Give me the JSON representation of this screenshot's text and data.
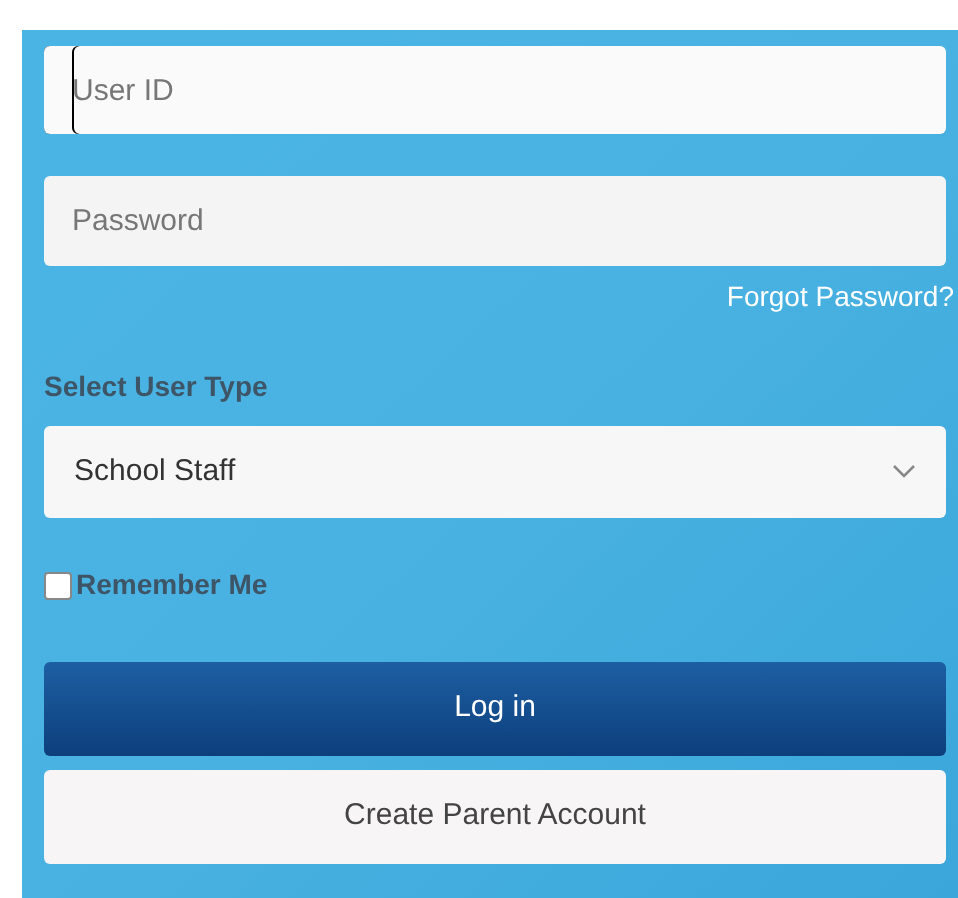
{
  "user_id": {
    "placeholder": "User ID",
    "focused": true
  },
  "password": {
    "placeholder": "Password"
  },
  "forgot_password_link": "Forgot Password?",
  "user_type": {
    "label": "Select User Type",
    "value": "School Staff"
  },
  "remember_me": {
    "label": "Remember Me",
    "checked": false
  },
  "buttons": [
    {
      "label": "Log in",
      "kind": "primary"
    },
    {
      "label": "Create Parent Account",
      "kind": "secondary"
    }
  ]
}
